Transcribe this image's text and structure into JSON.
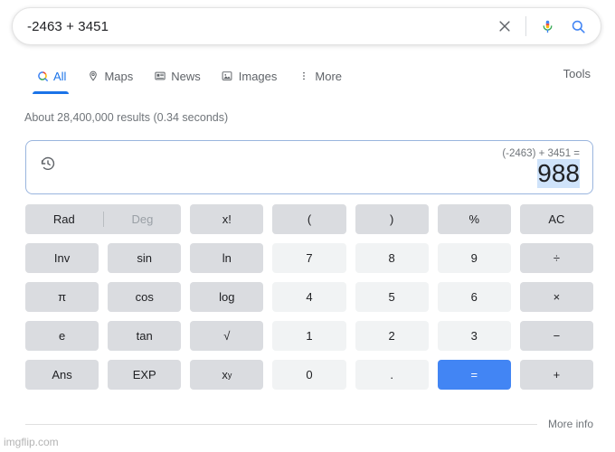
{
  "search": {
    "query": "-2463 + 3451",
    "clear_icon": "close-icon",
    "mic_icon": "microphone-icon",
    "search_icon": "search-icon"
  },
  "nav": {
    "items": [
      {
        "label": "All",
        "icon": "search-icon",
        "active": true
      },
      {
        "label": "Maps",
        "icon": "map-pin-icon",
        "active": false
      },
      {
        "label": "News",
        "icon": "news-icon",
        "active": false
      },
      {
        "label": "Images",
        "icon": "image-icon",
        "active": false
      },
      {
        "label": "More",
        "icon": "more-vertical-icon",
        "active": false
      }
    ],
    "tools_label": "Tools"
  },
  "results": {
    "stats": "About 28,400,000 results (0.34 seconds)"
  },
  "calculator": {
    "history_icon": "history-icon",
    "expression": "(-2463) + 3451 =",
    "result": "988",
    "result_highlight_color": "#cfe3fa",
    "accent_color": "#4285f4",
    "keys": [
      {
        "label": "Rad",
        "label2": "Deg",
        "name": "angle-unit-toggle",
        "type": "toggle"
      },
      {
        "label": "x!",
        "name": "factorial-button",
        "type": "fn"
      },
      {
        "label": "(",
        "name": "open-paren-button",
        "type": "fn"
      },
      {
        "label": ")",
        "name": "close-paren-button",
        "type": "fn"
      },
      {
        "label": "%",
        "name": "percent-button",
        "type": "fn"
      },
      {
        "label": "AC",
        "name": "all-clear-button",
        "type": "fn"
      },
      {
        "label": "Inv",
        "name": "inverse-button",
        "type": "fn"
      },
      {
        "label": "sin",
        "name": "sin-button",
        "type": "fn"
      },
      {
        "label": "ln",
        "name": "ln-button",
        "type": "fn"
      },
      {
        "label": "7",
        "name": "digit-7-button",
        "type": "num"
      },
      {
        "label": "8",
        "name": "digit-8-button",
        "type": "num"
      },
      {
        "label": "9",
        "name": "digit-9-button",
        "type": "num"
      },
      {
        "label": "÷",
        "name": "divide-button",
        "type": "fn"
      },
      {
        "label": "π",
        "name": "pi-button",
        "type": "fn"
      },
      {
        "label": "cos",
        "name": "cos-button",
        "type": "fn"
      },
      {
        "label": "log",
        "name": "log-button",
        "type": "fn"
      },
      {
        "label": "4",
        "name": "digit-4-button",
        "type": "num"
      },
      {
        "label": "5",
        "name": "digit-5-button",
        "type": "num"
      },
      {
        "label": "6",
        "name": "digit-6-button",
        "type": "num"
      },
      {
        "label": "×",
        "name": "multiply-button",
        "type": "fn"
      },
      {
        "label": "e",
        "name": "euler-button",
        "type": "fn"
      },
      {
        "label": "tan",
        "name": "tan-button",
        "type": "fn"
      },
      {
        "label": "√",
        "name": "square-root-button",
        "type": "fn"
      },
      {
        "label": "1",
        "name": "digit-1-button",
        "type": "num"
      },
      {
        "label": "2",
        "name": "digit-2-button",
        "type": "num"
      },
      {
        "label": "3",
        "name": "digit-3-button",
        "type": "num"
      },
      {
        "label": "−",
        "name": "subtract-button",
        "type": "fn"
      },
      {
        "label": "Ans",
        "name": "answer-button",
        "type": "fn"
      },
      {
        "label": "EXP",
        "name": "exponent-button",
        "type": "fn"
      },
      {
        "label": "x",
        "sup": "y",
        "name": "power-button",
        "type": "fn"
      },
      {
        "label": "0",
        "name": "digit-0-button",
        "type": "num"
      },
      {
        "label": ".",
        "name": "decimal-point-button",
        "type": "num"
      },
      {
        "label": "=",
        "name": "equals-button",
        "type": "equals"
      },
      {
        "label": "+",
        "name": "add-button",
        "type": "fn"
      }
    ],
    "more_info_label": "More info"
  },
  "watermark": "imgflip.com"
}
